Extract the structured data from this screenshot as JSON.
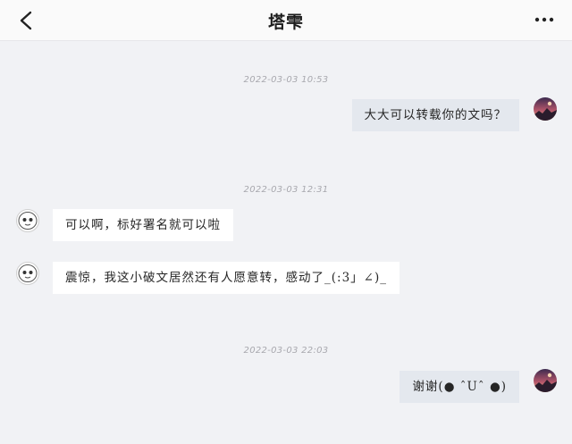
{
  "header": {
    "title": "塔雫",
    "back_icon": "chevron-left-icon",
    "more_icon": "more-horizontal-icon"
  },
  "messages": [
    {
      "type": "timestamp",
      "text": "2022-03-03 10:53"
    },
    {
      "type": "message",
      "side": "right",
      "text": "大大可以转载你的文吗？"
    },
    {
      "type": "timestamp",
      "text": "2022-03-03 12:31"
    },
    {
      "type": "message",
      "side": "left",
      "text": "可以啊，标好署名就可以啦"
    },
    {
      "type": "message",
      "side": "left",
      "text": "震惊，我这小破文居然还有人愿意转，感动了_(:3」∠)_"
    },
    {
      "type": "timestamp",
      "text": "2022-03-03 22:03"
    },
    {
      "type": "message",
      "side": "right",
      "text": "谢谢(● ˆUˆ ●)"
    }
  ],
  "colors": {
    "background": "#f1f2f5",
    "header": "#fafafa",
    "bubble_other": "#ffffff",
    "bubble_self": "#e4e8ee",
    "timestamp": "#a8a8ae"
  }
}
